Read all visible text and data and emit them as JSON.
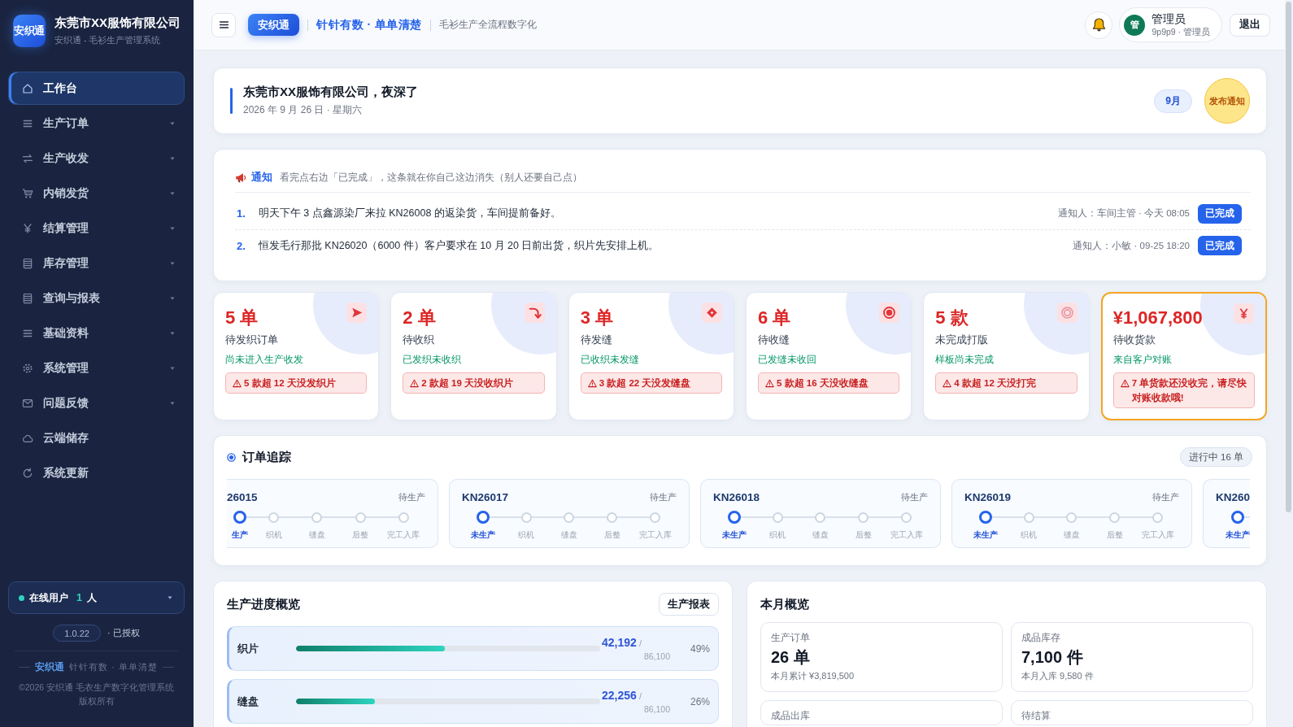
{
  "sidebar": {
    "logo": "安织通",
    "company": "东莞市XX服饰有限公司",
    "subtitle": "安织通 - 毛衫生产管理系统",
    "nav": [
      {
        "label": "工作台",
        "selected": true,
        "kind": "link"
      },
      {
        "label": "生产订单",
        "selected": false,
        "kind": "group"
      },
      {
        "label": "生产收发",
        "selected": false,
        "kind": "group"
      },
      {
        "label": "内销发货",
        "selected": false,
        "kind": "group"
      },
      {
        "label": "结算管理",
        "selected": false,
        "kind": "group"
      },
      {
        "label": "库存管理",
        "selected": false,
        "kind": "group"
      },
      {
        "label": "查询与报表",
        "selected": false,
        "kind": "group"
      },
      {
        "label": "基础资料",
        "selected": false,
        "kind": "group"
      },
      {
        "label": "系统管理",
        "selected": false,
        "kind": "group"
      },
      {
        "label": "问题反馈",
        "selected": false,
        "kind": "group"
      },
      {
        "label": "云端储存",
        "selected": false,
        "kind": "link"
      },
      {
        "label": "系统更新",
        "selected": false,
        "kind": "link"
      }
    ],
    "online": {
      "label": "在线用户",
      "count": "1",
      "unit": "人"
    },
    "version": "1.0.22",
    "license": "· 已授权",
    "footer": {
      "brand": "安织通",
      "slogan": "针针有数 · 单单清楚",
      "copyright": [
        "©2026 安织通 毛衣生产数字化管理系统",
        "版权所有"
      ]
    }
  },
  "topbar": {
    "brand": "安织通",
    "slogan": "针针有数 · 单单清楚",
    "tagline": "毛衫生产全流程数字化",
    "user": {
      "avatar": "管",
      "name": "管理员",
      "detail": "9p9p9 · 管理员"
    },
    "logout": "退出"
  },
  "greeting": {
    "title": "东莞市XX服饰有限公司，夜深了",
    "date": "2026 年 9 月 26 日 · 星期六",
    "month": "9月",
    "publish": "发布通知"
  },
  "notices": {
    "title": "通知",
    "hint": "看完点右边「已完成」，这条就在你自己这边消失（别人还要自己点）",
    "items": [
      {
        "number": "1.",
        "text": "明天下午 3 点鑫源染厂来拉 KN26008 的返染货，车间提前备好。",
        "meta": "通知人：车间主管 · 今天 08:05",
        "action": "已完成"
      },
      {
        "number": "2.",
        "text": "恒发毛行那批 KN26020（6000 件）客户要求在 10 月 20 日前出货，织片先安排上机。",
        "meta": "通知人：小敏 · 09-25 18:20",
        "action": "已完成"
      }
    ]
  },
  "stats": [
    {
      "value": "5 单",
      "label": "待发织订单",
      "note": "尚未进入生产收发",
      "warning": "5 款超 12 天没发织片",
      "highlighted": false
    },
    {
      "value": "2 单",
      "label": "待收织",
      "note": "已发织未收织",
      "warning": "2 款超 19 天没收织片",
      "highlighted": false
    },
    {
      "value": "3 单",
      "label": "待发缝",
      "note": "已收织未发缝",
      "warning": "3 款超 22 天没发缝盘",
      "highlighted": false
    },
    {
      "value": "6 单",
      "label": "待收缝",
      "note": "已发缝未收回",
      "warning": "5 款超 16 天没收缝盘",
      "highlighted": false
    },
    {
      "value": "5 款",
      "label": "未完成打版",
      "note": "样板尚未完成",
      "warning": "4 款超 12 天没打完",
      "highlighted": false
    },
    {
      "value": "¥1,067,800",
      "label": "待收货款",
      "note": "来自客户对账",
      "warning": "7 单货款还没收完，请尽快对账收款哦!",
      "highlighted": true
    }
  ],
  "tracking": {
    "title": "订单追踪",
    "badge": "进行中 16 单",
    "orders": [
      {
        "kind": "cut_left",
        "code": "26015",
        "status": "待生产",
        "steps": [
          {
            "label": "生产",
            "current": true
          },
          {
            "label": "织机",
            "current": false
          },
          {
            "label": "缝盘",
            "current": false
          },
          {
            "label": "后整",
            "current": false
          },
          {
            "label": "完工入库",
            "current": false
          }
        ]
      },
      {
        "kind": "full",
        "code": "KN26017",
        "status": "待生产",
        "steps": [
          {
            "label": "未生产",
            "current": true
          },
          {
            "label": "织机",
            "current": false
          },
          {
            "label": "缝盘",
            "current": false
          },
          {
            "label": "后整",
            "current": false
          },
          {
            "label": "完工入库",
            "current": false
          }
        ]
      },
      {
        "kind": "full",
        "code": "KN26018",
        "status": "待生产",
        "steps": [
          {
            "label": "未生产",
            "current": true
          },
          {
            "label": "织机",
            "current": false
          },
          {
            "label": "缝盘",
            "current": false
          },
          {
            "label": "后整",
            "current": false
          },
          {
            "label": "完工入库",
            "current": false
          }
        ]
      },
      {
        "kind": "full",
        "code": "KN26019",
        "status": "待生产",
        "steps": [
          {
            "label": "未生产",
            "current": true
          },
          {
            "label": "织机",
            "current": false
          },
          {
            "label": "缝盘",
            "current": false
          },
          {
            "label": "后整",
            "current": false
          },
          {
            "label": "完工入库",
            "current": false
          }
        ]
      },
      {
        "kind": "cut_right",
        "code": "KN260",
        "steps": [
          {
            "label": "未生产",
            "current": true
          }
        ]
      }
    ]
  },
  "production": {
    "title": "生产进度概览",
    "button": "生产报表",
    "rows": [
      {
        "label": "织片",
        "done": "**42,192** /",
        "total": "86,100",
        "percent": "49%",
        "level": 0.49
      },
      {
        "label": "缝盘",
        "done": "**22,256** /",
        "total": "86,100",
        "percent": "26%",
        "level": 0.26
      }
    ]
  },
  "month": {
    "title": "本月概览",
    "tiles": [
      {
        "label": "生产订单",
        "value": "26 单",
        "note": "本月累计 ¥3,819,500"
      },
      {
        "label": "成品库存",
        "value": "7,100 件",
        "note": "本月入库 9,580 件"
      },
      {
        "label": "成品出库"
      },
      {
        "label": "待结算"
      }
    ]
  }
}
